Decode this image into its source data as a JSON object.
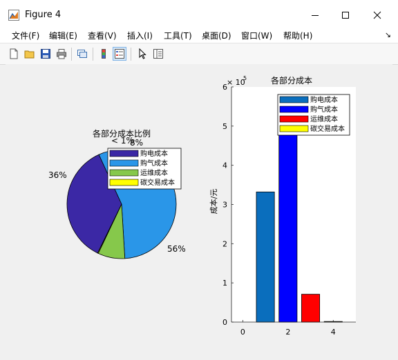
{
  "window": {
    "title": "Figure 4"
  },
  "menu": [
    "文件(F)",
    "编辑(E)",
    "查看(V)",
    "插入(I)",
    "工具(T)",
    "桌面(D)",
    "窗口(W)",
    "帮助(H)"
  ],
  "toolbar_icons": [
    "new-figure-icon",
    "open-file-icon",
    "save-icon",
    "print-icon",
    "link-plot-icon",
    "insert-colorbar-icon",
    "insert-legend-icon",
    "pointer-icon",
    "property-inspector-icon"
  ],
  "pie_chart": {
    "title": "各部分成本比例",
    "slice_labels": [
      "36%",
      "56%",
      "8%",
      "< 1%"
    ],
    "legend": [
      "购电成本",
      "购气成本",
      "运维成本",
      "碳交易成本"
    ]
  },
  "bar_chart": {
    "title": "各部分成本",
    "ylabel": "成本/元",
    "exponent_base": "× 10",
    "exponent_power": "5",
    "xticks": [
      "0",
      "2",
      "4"
    ],
    "yticks": [
      "0",
      "1",
      "2",
      "3",
      "4",
      "5",
      "6"
    ],
    "legend": [
      "购电成本",
      "购气成本",
      "运维成本",
      "碳交易成本"
    ]
  },
  "colors": {
    "pie": [
      "#3b28a5",
      "#2a96e8",
      "#86c84b",
      "#ffff00"
    ],
    "bar": [
      "#0a6ebd",
      "#0000ff",
      "#ff0000",
      "#ffff00"
    ]
  },
  "chart_data": [
    {
      "type": "pie",
      "title": "各部分成本比例",
      "labels": [
        "购电成本",
        "购气成本",
        "运维成本",
        "碳交易成本"
      ],
      "values": [
        36,
        56,
        8,
        0.2
      ]
    },
    {
      "type": "bar",
      "title": "各部分成本",
      "xlabel": "",
      "ylabel": "成本/元",
      "x": [
        1,
        2,
        3,
        4
      ],
      "values": [
        332000,
        514000,
        71000,
        1500
      ],
      "series_names": [
        "购电成本",
        "购气成本",
        "运维成本",
        "碳交易成本"
      ],
      "xlim": [
        -0.5,
        5
      ],
      "ylim": [
        0,
        600000
      ]
    }
  ]
}
